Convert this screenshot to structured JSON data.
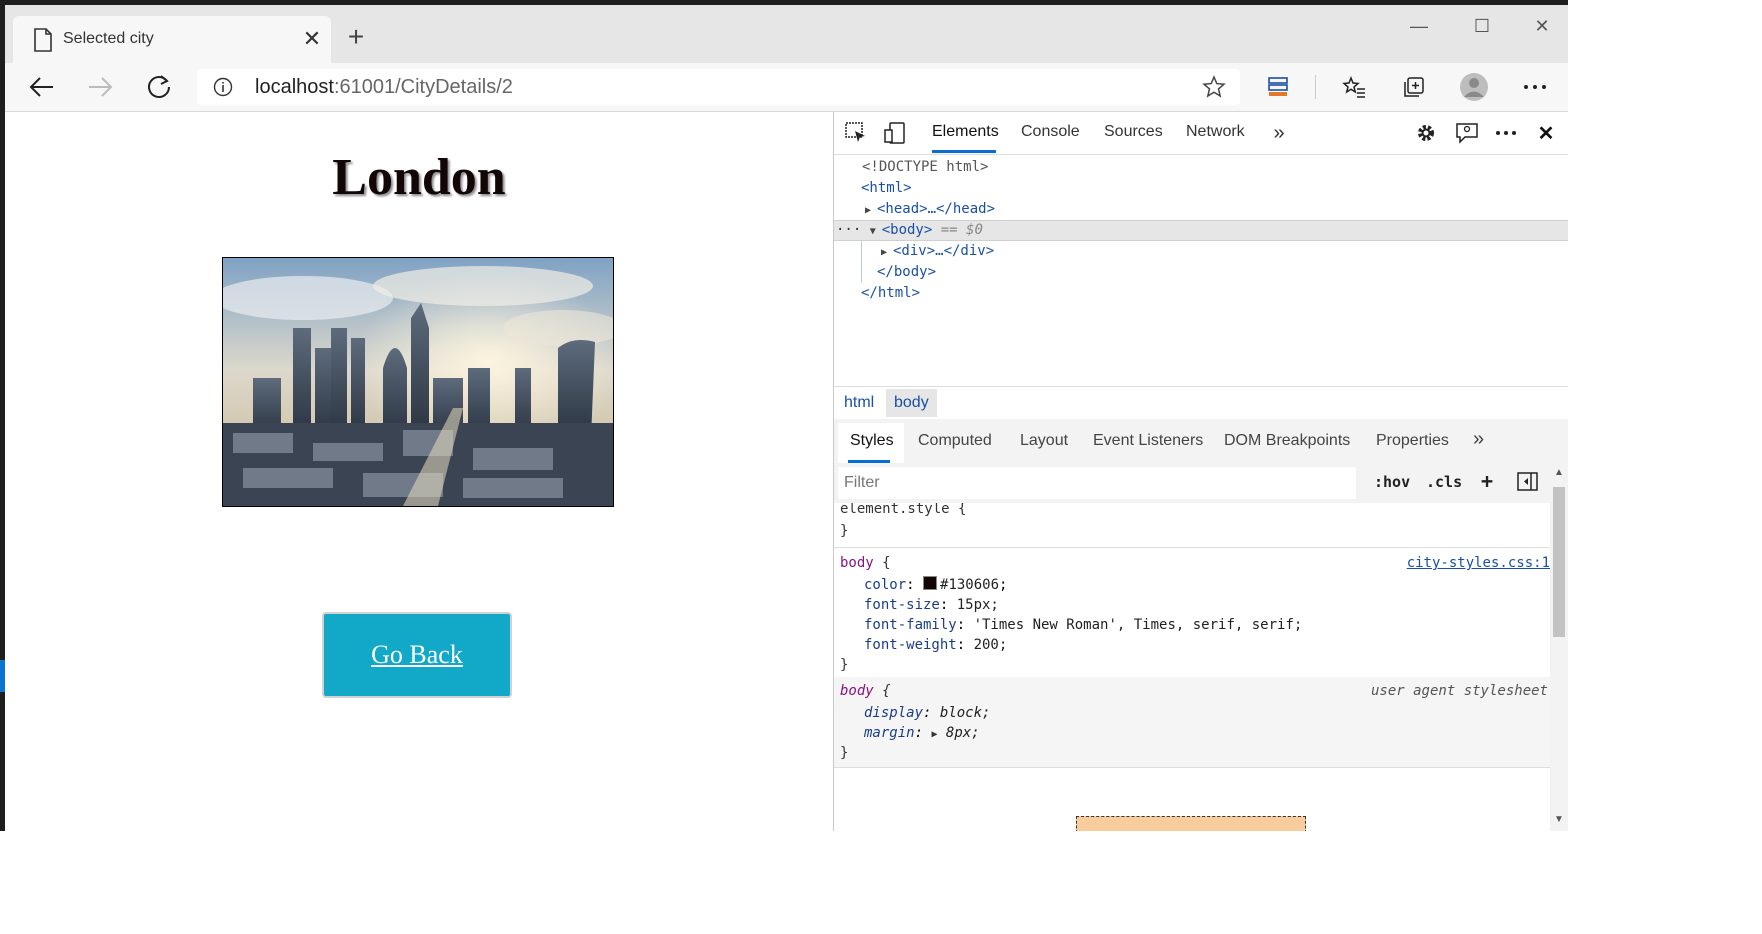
{
  "tab": {
    "title": "Selected city"
  },
  "address": {
    "host": "localhost",
    "rest": ":61001/CityDetails/2"
  },
  "page": {
    "heading": "London",
    "image_alt": "London skyline",
    "back_button": "Go Back"
  },
  "devtools": {
    "tabs": [
      "Elements",
      "Console",
      "Sources",
      "Network"
    ],
    "dom": {
      "doctype": "<!DOCTYPE html>",
      "html_open": "<html>",
      "head": "<head>…</head>",
      "body_open": "<body>",
      "body_ref": "== $0",
      "div": "<div>…</div>",
      "body_close": "</body>",
      "html_close": "</html>"
    },
    "breadcrumbs": [
      "html",
      "body"
    ],
    "subtabs": [
      "Styles",
      "Computed",
      "Layout",
      "Event Listeners",
      "DOM Breakpoints",
      "Properties"
    ],
    "filter_placeholder": "Filter",
    "filter_tools": {
      "hov": ":hov",
      "cls": ".cls",
      "add": "+"
    },
    "styles": {
      "element_style": "element.style {",
      "close": "}",
      "rule1_selector": "body",
      "rule1_open": " {",
      "rule1_source": "city-styles.css:1",
      "rule1_props": [
        {
          "name": "color",
          "value": "#130606"
        },
        {
          "name": "font-size",
          "value": "15px;"
        },
        {
          "name": "font-family",
          "value": "'Times New Roman', Times, serif, serif;"
        },
        {
          "name": "font-weight",
          "value": "200;"
        }
      ],
      "rule2_selector": "body",
      "rule2_open": " {",
      "rule2_source": "user agent stylesheet",
      "rule2_props": [
        {
          "name": "display",
          "value": "block;"
        },
        {
          "name": "margin",
          "value": "8px;"
        }
      ]
    }
  },
  "colors": {
    "button": "#12a8c8",
    "text": "#130606",
    "accent": "#0a6ed1"
  }
}
